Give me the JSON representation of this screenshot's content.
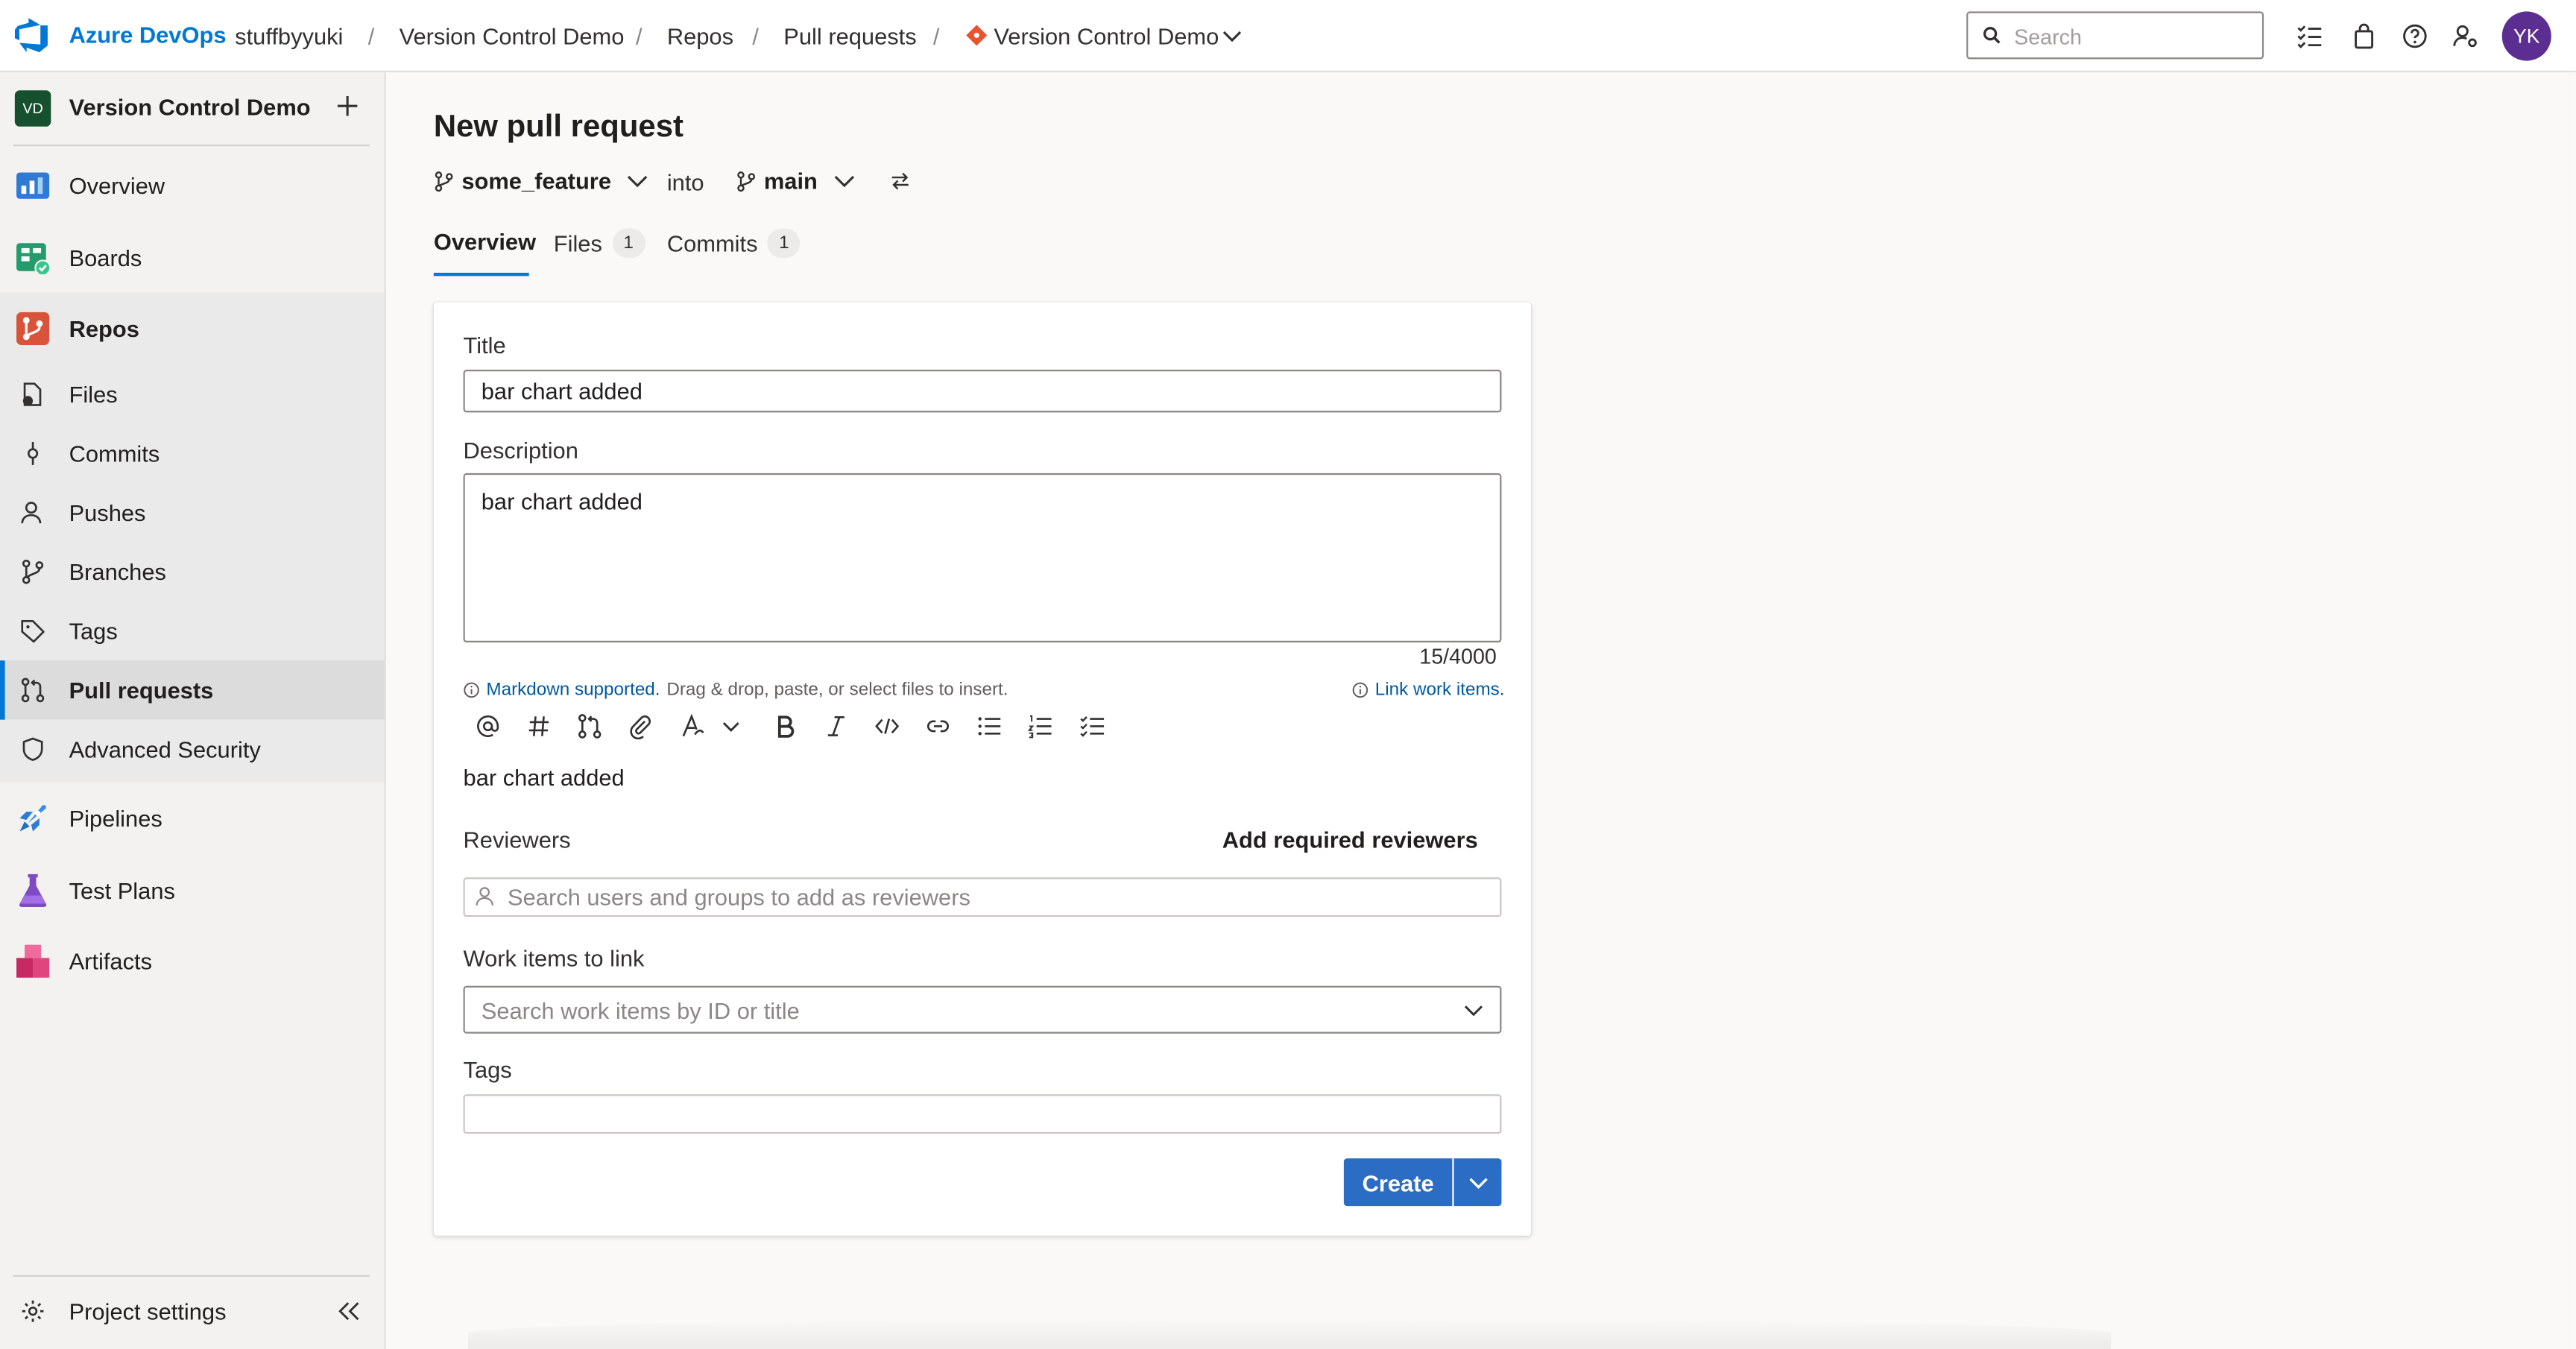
{
  "colors": {
    "brand": "#0078d4",
    "primary_button": "#2b6cc4",
    "avatar": "#5c2e91",
    "project_badge": "#15502f"
  },
  "topbar": {
    "brand": "Azure DevOps",
    "org": "stuffbyyuki",
    "breadcrumbs": [
      "Version Control Demo",
      "Repos",
      "Pull requests",
      "Version Control Demo"
    ],
    "separator": "/",
    "search_placeholder": "Search",
    "icons": [
      "task-list-icon",
      "shopping-bag-icon",
      "help-icon",
      "user-settings-icon"
    ],
    "avatar_initials": "YK"
  },
  "sidebar": {
    "project_badge": "VD",
    "project_name": "Version Control Demo",
    "items": [
      {
        "label": "Overview",
        "icon": "overview-icon"
      },
      {
        "label": "Boards",
        "icon": "boards-icon"
      },
      {
        "label": "Repos",
        "icon": "repos-icon"
      },
      {
        "label": "Files",
        "icon": "files-icon"
      },
      {
        "label": "Commits",
        "icon": "commits-icon"
      },
      {
        "label": "Pushes",
        "icon": "pushes-icon"
      },
      {
        "label": "Branches",
        "icon": "branches-icon"
      },
      {
        "label": "Tags",
        "icon": "tags-icon"
      },
      {
        "label": "Pull requests",
        "icon": "pull-requests-icon"
      },
      {
        "label": "Advanced Security",
        "icon": "shield-icon"
      },
      {
        "label": "Pipelines",
        "icon": "pipelines-icon"
      },
      {
        "label": "Test Plans",
        "icon": "test-plans-icon"
      },
      {
        "label": "Artifacts",
        "icon": "artifacts-icon"
      }
    ],
    "active_item": "Pull requests",
    "settings_label": "Project settings"
  },
  "main": {
    "title": "New pull request",
    "source_branch": "some_feature",
    "into_label": "into",
    "target_branch": "main",
    "tabs": [
      {
        "label": "Overview"
      },
      {
        "label": "Files",
        "count": "1"
      },
      {
        "label": "Commits",
        "count": "1"
      }
    ],
    "form": {
      "title_label": "Title",
      "title_value": "bar chart added",
      "description_label": "Description",
      "description_value": "bar chart added",
      "char_count": "15/4000",
      "markdown_link": "Markdown supported.",
      "markdown_hint": "Drag & drop, paste, or select files to insert.",
      "link_work_items": "Link work items.",
      "preview_text": "bar chart added",
      "reviewers_label": "Reviewers",
      "add_required_reviewers": "Add required reviewers",
      "reviewers_placeholder": "Search users and groups to add as reviewers",
      "work_items_label": "Work items to link",
      "work_items_placeholder": "Search work items by ID or title",
      "tags_label": "Tags",
      "tags_value": "",
      "create_label": "Create"
    }
  }
}
